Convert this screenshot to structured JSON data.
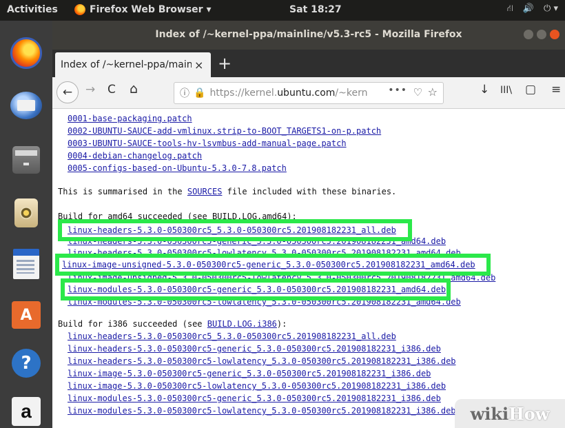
{
  "topbar": {
    "activities": "Activities",
    "app_name": "Firefox Web Browser ▾",
    "clock": "Sat 18:27",
    "tray": [
      "⛙",
      "🔊",
      "⏻ ▾"
    ]
  },
  "window": {
    "title": "Index of /~kernel-ppa/mainline/v5.3-rc5 - Mozilla Firefox"
  },
  "tab": {
    "label": "Index of /~kernel-ppa/mainline/v5.3-rc5",
    "close": "×",
    "new_tab": "+"
  },
  "nav": {
    "back": "←",
    "forward": "→",
    "reload": "C",
    "home": "⌂",
    "info": "ⓘ",
    "lock": "🔒",
    "url_prefix": "https://kernel.",
    "url_host": "ubuntu.com",
    "url_rest": "/~kern",
    "more": "•••",
    "pocket": "♡",
    "star": "☆",
    "download": "↓",
    "library": "III\\",
    "sidebar": "▢",
    "menu": "≡"
  },
  "content": {
    "patches": [
      "0001-base-packaging.patch",
      "0002-UBUNTU-SAUCE-add-vmlinux.strip-to-BOOT_TARGETS1-on-p.patch",
      "0003-UBUNTU-SAUCE-tools-hv-lsvmbus-add-manual-page.patch",
      "0004-debian-changelog.patch",
      "0005-configs-based-on-Ubuntu-5.3.0-7.8.patch"
    ],
    "summary_before": "This is summarised in the ",
    "summary_link": "SOURCES",
    "summary_after": " file included with these binaries.",
    "amd64_header": "Build for amd64 succeeded (see BUILD.LOG.amd64):",
    "amd64_files": [
      "linux-headers-5.3.0-050300rc5_5.3.0-050300rc5.201908182231_all.deb",
      "linux-headers-5.3.0-050300rc5-generic_5.3.0-050300rc5.201908182231_amd64.deb",
      "linux-headers-5.3.0-050300rc5-lowlatency_5.3.0-050300rc5.201908182231_amd64.deb",
      "linux-image-unsigned-5.3.0-050300rc5-generic_5.3.0-050300rc5.201908182231_amd64.deb",
      "linux-image-unsigned-5.3.0-050300rc5-lowlatency_5.3.0-050300rc5.201908182231_amd64.deb",
      "linux-modules-5.3.0-050300rc5-generic_5.3.0-050300rc5.201908182231_amd64.deb",
      "linux-modules-5.3.0-050300rc5-lowlatency_5.3.0-050300rc5.201908182231_amd64.deb"
    ],
    "i386_header_before": "Build for i386 succeeded (see ",
    "i386_header_link": "BUILD.LOG.i386",
    "i386_header_after": "):",
    "i386_files": [
      "linux-headers-5.3.0-050300rc5_5.3.0-050300rc5.201908182231_all.deb",
      "linux-headers-5.3.0-050300rc5-generic_5.3.0-050300rc5.201908182231_i386.deb",
      "linux-headers-5.3.0-050300rc5-lowlatency_5.3.0-050300rc5.201908182231_i386.deb",
      "linux-image-5.3.0-050300rc5-generic_5.3.0-050300rc5.201908182231_i386.deb",
      "linux-image-5.3.0-050300rc5-lowlatency_5.3.0-050300rc5.201908182231_i386.deb",
      "linux-modules-5.3.0-050300rc5-generic_5.3.0-050300rc5.201908182231_i386.deb",
      "linux-modules-5.3.0-050300rc5-lowlatency_5.3.0-050300rc5.201908182231_i386.deb"
    ]
  },
  "watermark": {
    "part1": "wiki",
    "part2": "How"
  },
  "colors": {
    "highlight": "#2be84a",
    "link": "#1a1aa6",
    "ubuntu_orange": "#e95420"
  },
  "dock_icons": [
    "firefox-icon",
    "thunderbird-icon",
    "files-icon",
    "rhythmbox-icon",
    "libreoffice-writer-icon",
    "ubuntu-software-icon",
    "help-icon",
    "amazon-icon"
  ]
}
